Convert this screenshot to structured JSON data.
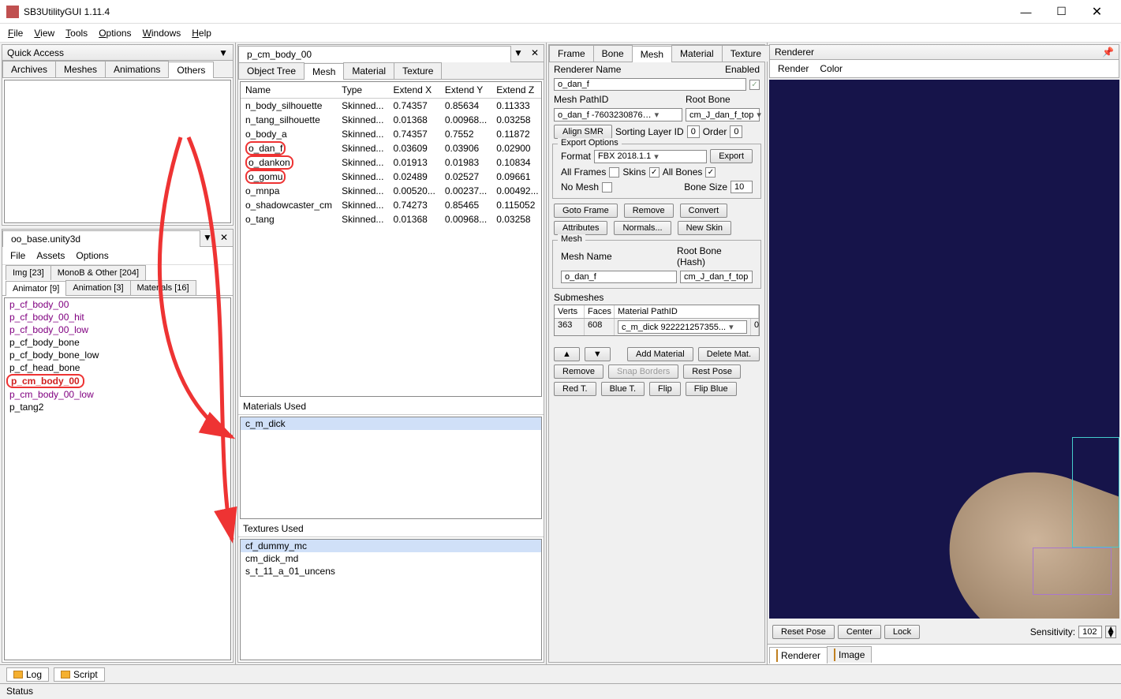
{
  "window": {
    "title": "SB3UtilityGUI 1.11.4"
  },
  "menu": {
    "file": "File",
    "view": "View",
    "tools": "Tools",
    "options": "Options",
    "windows": "Windows",
    "help": "Help"
  },
  "quickAccess": {
    "title": "Quick Access",
    "tabs": {
      "archives": "Archives",
      "meshes": "Meshes",
      "animations": "Animations",
      "others": "Others"
    }
  },
  "ooBase": {
    "title": "oo_base.unity3d",
    "menu": {
      "file": "File",
      "assets": "Assets",
      "options": "Options"
    },
    "tabsTop": {
      "img": "Img  [23]",
      "mono": "MonoB & Other  [204]"
    },
    "tabsBot": {
      "animator": "Animator [9]",
      "animation": "Animation [3]",
      "materials": "Materials [16]"
    },
    "items": [
      {
        "t": "p_cf_body_00",
        "c": "purple"
      },
      {
        "t": "p_cf_body_00_hit",
        "c": "purple"
      },
      {
        "t": "p_cf_body_00_low",
        "c": "purple"
      },
      {
        "t": "p_cf_body_bone",
        "c": ""
      },
      {
        "t": "p_cf_body_bone_low",
        "c": ""
      },
      {
        "t": "p_cf_head_bone",
        "c": ""
      },
      {
        "t": "p_cm_body_00",
        "c": "hot"
      },
      {
        "t": "p_cm_body_00_low",
        "c": "purple"
      },
      {
        "t": "p_tang2",
        "c": ""
      }
    ]
  },
  "midDoc": {
    "title": "p_cm_body_00",
    "tabs": {
      "objtree": "Object Tree",
      "mesh": "Mesh",
      "material": "Material",
      "texture": "Texture"
    },
    "headers": {
      "name": "Name",
      "type": "Type",
      "ex": "Extend X",
      "ey": "Extend Y",
      "ez": "Extend Z"
    },
    "rows": [
      {
        "n": "n_body_silhouette",
        "t": "Skinned...",
        "ex": "0.74357",
        "ey": "0.85634",
        "ez": "0.11333"
      },
      {
        "n": "n_tang_silhouette",
        "t": "Skinned...",
        "ex": "0.01368",
        "ey": "0.00968...",
        "ez": "0.03258"
      },
      {
        "n": "o_body_a",
        "t": "Skinned...",
        "ex": "0.74357",
        "ey": "0.7552",
        "ez": "0.11872"
      },
      {
        "n": "o_dan_f",
        "t": "Skinned...",
        "ex": "0.03609",
        "ey": "0.03906",
        "ez": "0.02900",
        "r": true
      },
      {
        "n": "o_dankon",
        "t": "Skinned...",
        "ex": "0.01913",
        "ey": "0.01983",
        "ez": "0.10834",
        "r": true
      },
      {
        "n": "o_gomu",
        "t": "Skinned...",
        "ex": "0.02489",
        "ey": "0.02527",
        "ez": "0.09661",
        "r": true
      },
      {
        "n": "o_mnpa",
        "t": "Skinned...",
        "ex": "0.00520...",
        "ey": "0.00237...",
        "ez": "0.00492..."
      },
      {
        "n": "o_shadowcaster_cm",
        "t": "Skinned...",
        "ex": "0.74273",
        "ey": "0.85465",
        "ez": "0.115052"
      },
      {
        "n": "o_tang",
        "t": "Skinned...",
        "ex": "0.01368",
        "ey": "0.00968...",
        "ez": "0.03258"
      }
    ],
    "matUsedHdr": "Materials Used",
    "matUsed": "c_m_dick",
    "texUsedHdr": "Textures Used",
    "texUsed": [
      "cf_dummy_mc",
      "cm_dick_md",
      "s_t_11_a_01_uncens"
    ]
  },
  "meshPanel": {
    "tabs": {
      "frame": "Frame",
      "bone": "Bone",
      "mesh": "Mesh",
      "material": "Material",
      "texture": "Texture"
    },
    "rendererName": "Renderer Name",
    "enabled": "Enabled",
    "rendererVal": "o_dan_f",
    "meshPathID": "Mesh PathID",
    "rootBone": "Root Bone",
    "pathIdVal": "o_dan_f -7603230876…",
    "rootBoneVal": "cm_J_dan_f_top",
    "alignSMR": "Align SMR",
    "sortingLayerID": "Sorting Layer ID",
    "sortingVal": "0",
    "order": "Order",
    "orderVal": "0",
    "exportOptions": "Export Options",
    "format": "Format",
    "formatVal": "FBX 2018.1.1",
    "export": "Export",
    "allFrames": "All Frames",
    "skins": "Skins",
    "allBones": "All Bones",
    "noMesh": "No Mesh",
    "boneSize": "Bone Size",
    "boneSizeVal": "10",
    "gotoFrame": "Goto Frame",
    "remove": "Remove",
    "convert": "Convert",
    "attributes": "Attributes",
    "normals": "Normals...",
    "newSkin": "New Skin",
    "meshHdr": "Mesh",
    "meshName": "Mesh Name",
    "rootBoneHash": "Root Bone (Hash)",
    "meshNameVal": "o_dan_f",
    "rootHashVal": "cm_J_dan_f_top",
    "submeshes": "Submeshes",
    "subHead": {
      "verts": "Verts",
      "faces": "Faces",
      "matpath": "Material PathID"
    },
    "subRow": {
      "verts": "363",
      "faces": "608",
      "mat": "c_m_dick 922221257355...",
      "o": "0"
    },
    "up": "▲",
    "down": "▼",
    "addMat": "Add Material",
    "delMat": "Delete Mat.",
    "remove2": "Remove",
    "snap": "Snap Borders",
    "restPose": "Rest Pose",
    "redT": "Red T.",
    "blueT": "Blue T.",
    "flip": "Flip",
    "flipBlue": "Flip Blue"
  },
  "renderer": {
    "title": "Renderer",
    "menu": {
      "render": "Render",
      "color": "Color"
    },
    "resetPose": "Reset Pose",
    "center": "Center",
    "lock": "Lock",
    "sensitivity": "Sensitivity:",
    "sensVal": "102",
    "tabs": {
      "renderer": "Renderer",
      "image": "Image"
    }
  },
  "bottom": {
    "log": "Log",
    "script": "Script"
  },
  "status": "Status"
}
